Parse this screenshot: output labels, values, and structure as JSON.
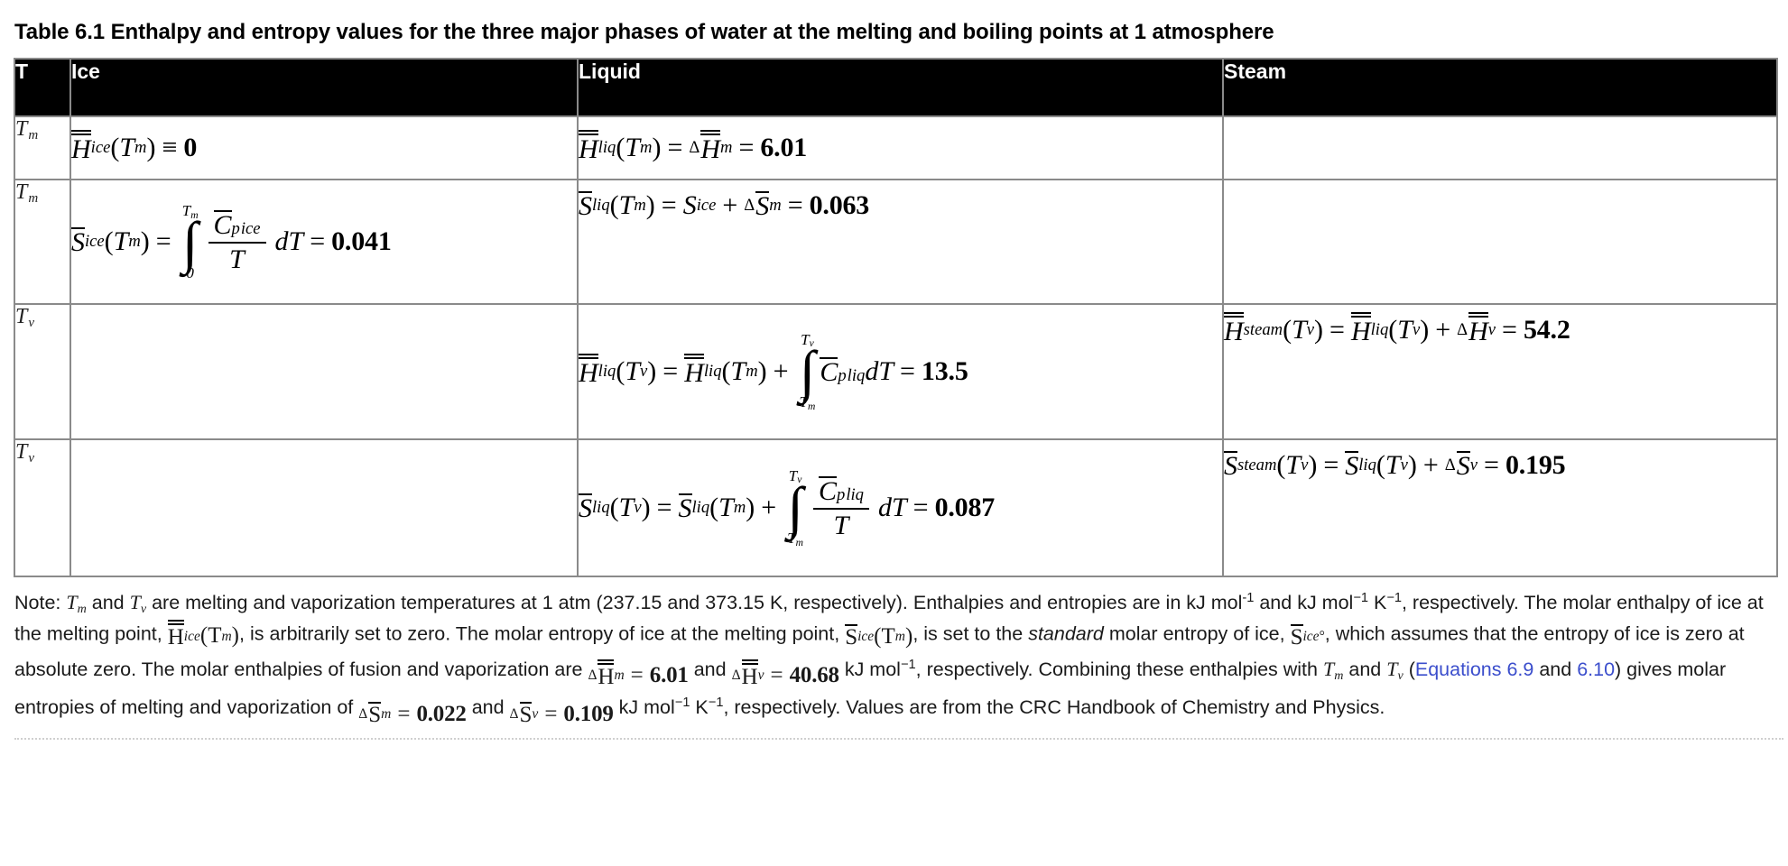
{
  "caption": "Table 6.1 Enthalpy and entropy values for the three major phases of water at the melting and boiling points at 1 atmosphere",
  "table": {
    "headers": [
      "T",
      "Ice",
      "Liquid",
      "Steam"
    ],
    "rows": [
      {
        "t": "Tm",
        "t_base": "T",
        "t_sub": "m",
        "ice": "H̄^ice(T_m) ≡ 0",
        "liquid": "H̄^liq(T_m) = ΔH̄_m = 6.01",
        "steam": ""
      },
      {
        "t": "Tm",
        "t_base": "T",
        "t_sub": "m",
        "ice": "S̄^ice(T_m) = ∫_0^{T_m} (C̄_p^ice / T) dT = 0.041",
        "liquid": "S̄^liq(T_m) = S^ice + ΔS̄_m = 0.063",
        "steam": ""
      },
      {
        "t": "Tv",
        "t_base": "T",
        "t_sub": "v",
        "ice": "",
        "liquid": "H̄^liq(T_v) = H̄^liq(T_m) + ∫_{T_m}^{T_v} C̄_p^liq dT = 13.5",
        "steam": "H̄^steam(T_v) = H̄^liq(T_v) + ΔH̄_v = 54.2"
      },
      {
        "t": "Tv",
        "t_base": "T",
        "t_sub": "v",
        "ice": "",
        "liquid": "S̄^liq(T_v) = S̄^liq(T_m) + ∫_{T_m}^{T_v} (C̄_p^liq / T) dT = 0.087",
        "steam": "S̄^steam(T_v) = S̄^liq(T_v) + ΔS̄_v = 0.195"
      }
    ],
    "symbols": {
      "H": "H",
      "S": "S",
      "C": "C",
      "T": "T",
      "p": "p",
      "dT": "dT",
      "delta": "Δ",
      "equiv": "≡",
      "equals": "=",
      "plus": "+",
      "integral": "∫",
      "zero_limit": "0",
      "sup_ice": "ice",
      "sup_liq": "liq",
      "sup_steam": "steam",
      "sub_m": "m",
      "sub_v": "v",
      "paren_open": "(",
      "paren_close": ")"
    },
    "values": {
      "r1_liquid": "6.01",
      "r1_ice": "0",
      "r2_ice": "0.041",
      "r2_liquid": "0.063",
      "r3_liquid": "13.5",
      "r3_steam": "54.2",
      "r4_liquid": "0.087",
      "r4_steam": "0.195"
    }
  },
  "note": {
    "label": "Note:",
    "seg1": " and ",
    "seg2": " are melting and vaporization temperatures at 1 atm (237.15 and 373.15 K, respectively). Enthalpies and entropies are in kJ mol",
    "sup_neg1": "-1",
    "seg3": " and kJ mol",
    "sup_neg1b": "−1",
    "seg4": " K",
    "sup_neg1c": "−1",
    "seg5": ", respectively. The molar enthalpy of ice at the melting point, ",
    "seg6": ", is arbitrarily set to zero. The molar entropy of ice at the melting point, ",
    "seg7": ", is set to the ",
    "standard_word": "standard",
    "seg8": " molar entropy of ice, ",
    "seg9": ", which assumes that the entropy of ice is zero at absolute zero. The molar enthalpies of fusion and vaporization are ",
    "eq_dHm": "6.01",
    "seg10": " and ",
    "eq_dHv": "40.68",
    "seg11": " kJ mol",
    "sup_neg1d": "−1",
    "seg12": ", respectively. Combining these enthalpies with ",
    "seg13": " and ",
    "paren_open": " (",
    "link1": "Equations 6.9",
    "seg14": " and ",
    "link2": "6.10",
    "seg15": ") gives molar entropies of melting and vaporization of ",
    "eq_dSm": "0.022",
    "seg16": " and ",
    "eq_dSv": "0.109",
    "seg17": " kJ mol",
    "sup_neg1e": "−1",
    "seg18": " K",
    "sup_neg1f": "−1",
    "seg19": ", respectively. Values are from the CRC Handbook of Chemistry and Physics."
  },
  "colors": {
    "header_bg": "#000000",
    "header_text": "#ffffff",
    "border": "#8a8a8a",
    "link": "#3b4ecc",
    "body_text": "#1a1a1a"
  }
}
